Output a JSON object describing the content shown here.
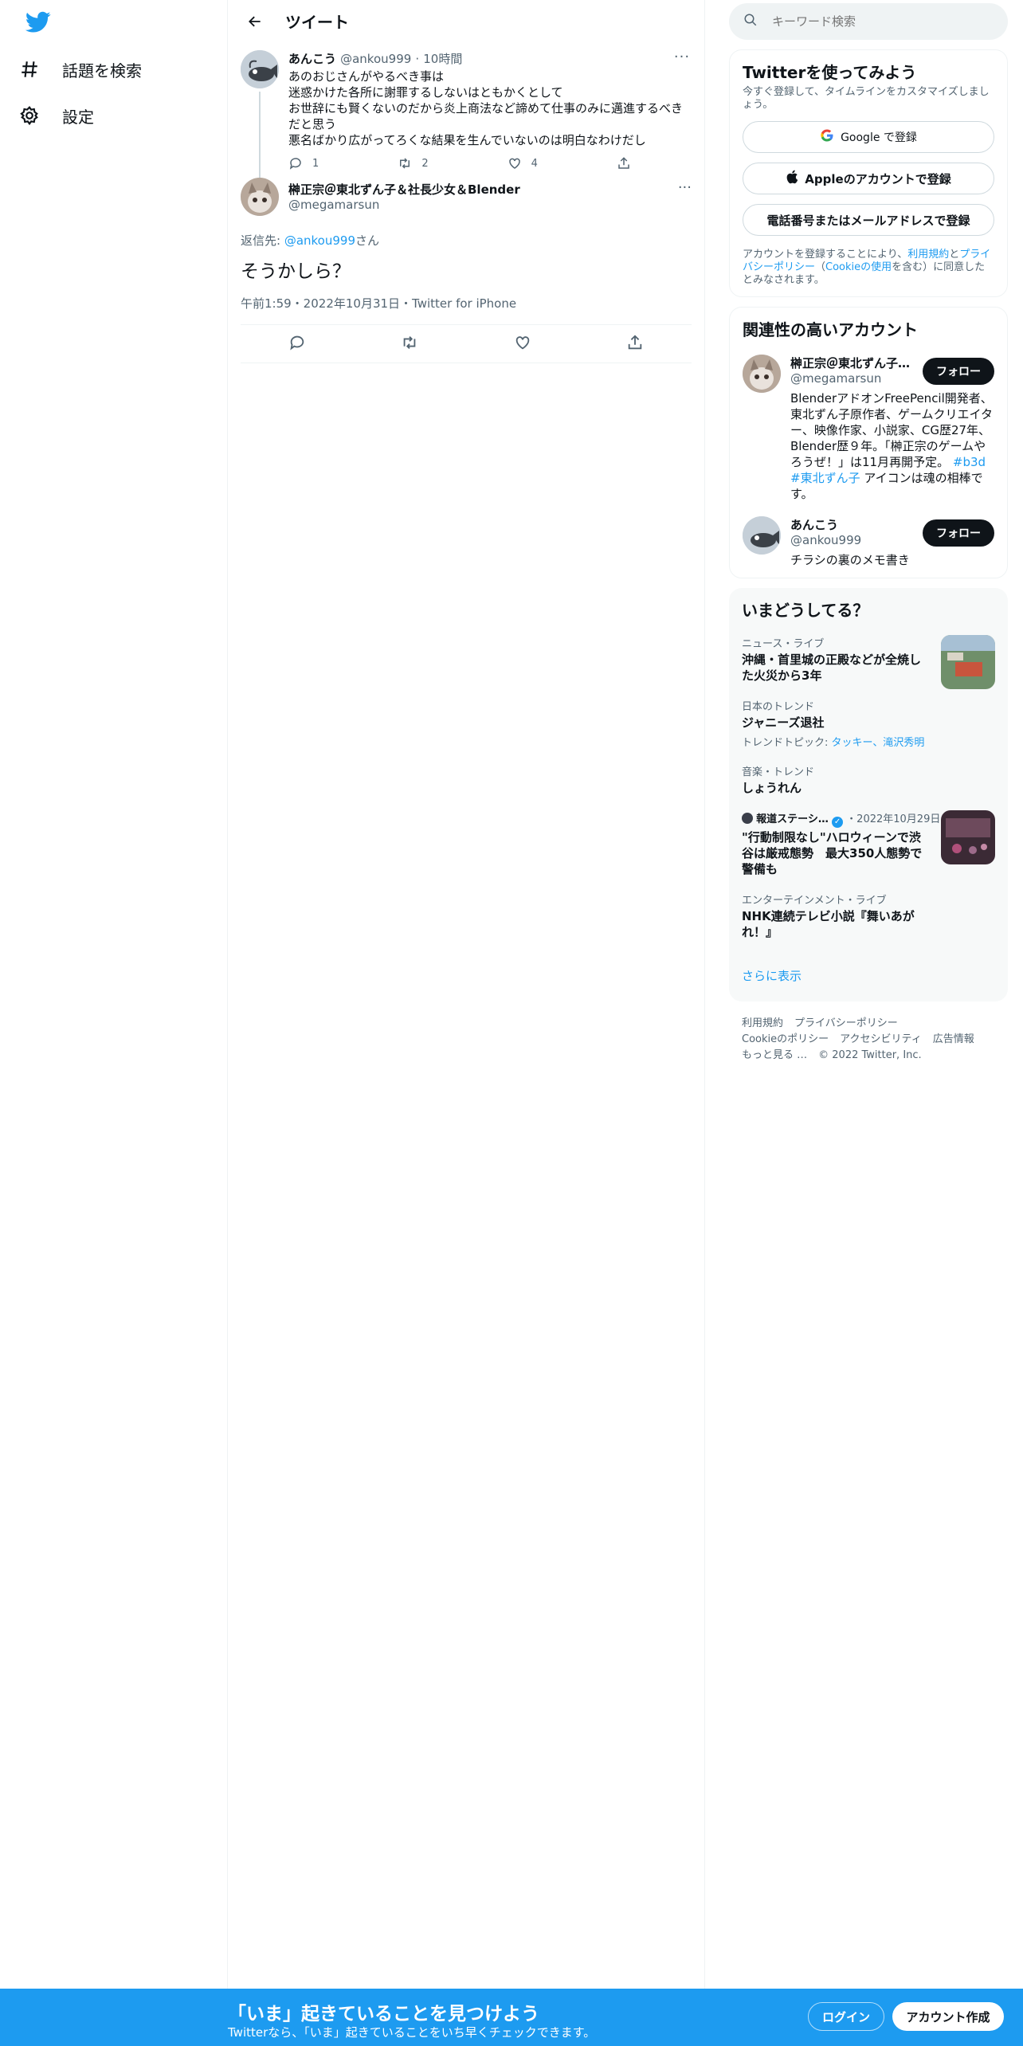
{
  "nav": {
    "explore_label": "話題を検索",
    "settings_label": "設定"
  },
  "header": {
    "title": "ツイート"
  },
  "parent_tweet": {
    "name": "あんこう",
    "handle": "@ankou999",
    "time": "10時間",
    "lines": [
      "あのおじさんがやるべき事は",
      "迷惑かけた各所に謝罪するしないはともかくとして",
      "お世辞にも賢くないのだから炎上商法など諦めて仕事のみに邁進するべきだと思う",
      "悪名ばかり広がってろくな結果を生んでいないのは明白なわけだし"
    ],
    "reply_count": "1",
    "retweet_count": "2",
    "like_count": "4"
  },
  "focal_tweet": {
    "name": "榊正宗＠東北ずん子＆社長少女＆Blender",
    "handle": "@megamarsun",
    "reply_prefix": "返信先: ",
    "reply_to": "@ankou999",
    "reply_suffix": "さん",
    "text": "そうかしら？",
    "meta": "午前1:59・2022年10月31日・Twitter for iPhone"
  },
  "search": {
    "placeholder": "キーワード検索"
  },
  "signup_card": {
    "title": "Twitterを使ってみよう",
    "subtitle": "今すぐ登録して、タイムラインをカスタマイズしましょう。",
    "google_label": "Google で登録",
    "apple_label": "Appleのアカウントで登録",
    "phone_label": "電話番号またはメールアドレスで登録",
    "legal_prefix": "アカウントを登録することにより、",
    "legal_terms": "利用規約",
    "legal_and": "と",
    "legal_privacy": "プライバシーポリシー",
    "legal_open": "（",
    "legal_cookie": "Cookieの使用",
    "legal_suffix": "を含む）に同意したとみなされます。"
  },
  "related": {
    "title": "関連性の高いアカウント",
    "follow_label": "フォロー",
    "accounts": [
      {
        "name": "榊正宗＠東北ずん子…",
        "handle": "@megamarsun",
        "bio": "BlenderアドオンFreePencil開発者、東北ずん子原作者、ゲームクリエイター、映像作家、小説家、CG歴27年、Blender歴９年。「榊正宗のゲームやろうぜ！」は11月再開予定。",
        "bio_tags": "#b3d #東北ずん子",
        "bio_tail": " アイコンは魂の相棒です。"
      },
      {
        "name": "あんこう",
        "handle": "@ankou999",
        "bio": "チラシの裏のメモ書き"
      }
    ]
  },
  "trends": {
    "title": "いまどうしてる？",
    "items": [
      {
        "category": "ニュース・ライブ",
        "name": "沖縄・首里城の正殿などが全焼した火災から3年"
      },
      {
        "category": "日本のトレンド",
        "name": "ジャニーズ退社",
        "topics_label": "トレンドトピック: ",
        "topics": "タッキー、滝沢秀明"
      },
      {
        "category": "音楽・トレンド",
        "name": "しょうれん"
      },
      {
        "source": "報道ステーシ…",
        "date": "・2022年10月29日",
        "name": "\"行動制限なし\"ハロウィーンで渋谷は厳戒態勢　最大350人態勢で警備も"
      },
      {
        "category": "エンターテインメント・ライブ",
        "name": "NHK連続テレビ小説『舞いあがれ！』"
      }
    ],
    "show_more": "さらに表示"
  },
  "footer": {
    "terms": "利用規約",
    "privacy": "プライバシーポリシー",
    "cookie": "Cookieのポリシー",
    "accessibility": "アクセシビリティ",
    "ads": "広告情報",
    "more": "もっと見る …",
    "copyright": "© 2022 Twitter, Inc."
  },
  "bottom_bar": {
    "title": "「いま」起きていることを見つけよう",
    "subtitle": "Twitterなら、「いま」起きていることをいち早くチェックできます。",
    "login_label": "ログイン",
    "signup_label": "アカウント作成"
  },
  "colors": {
    "accent": "#1d9bf0",
    "text": "#0f1419",
    "muted": "#536471"
  }
}
